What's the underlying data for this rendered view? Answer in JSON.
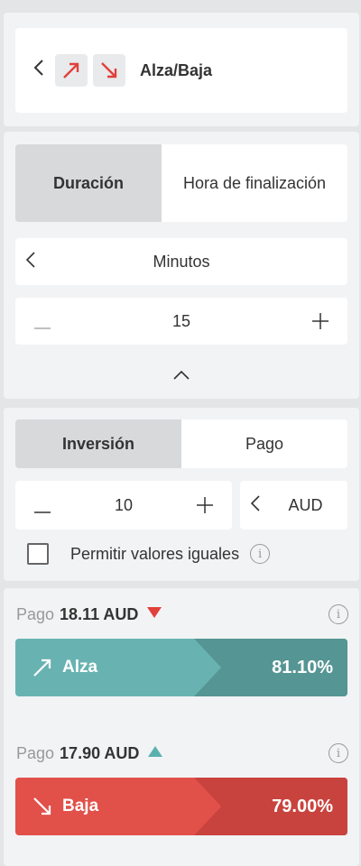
{
  "contract": {
    "back_icon": "chevron-left-icon",
    "title": "Alza/Baja"
  },
  "duration": {
    "tabs": [
      {
        "label": "Duración",
        "active": true
      },
      {
        "label": "Hora de finalización",
        "active": false
      }
    ],
    "unit": "Minutos",
    "value": "15",
    "minus": "—",
    "plus": "+"
  },
  "stake": {
    "tabs": [
      {
        "label": "Inversión",
        "active": true
      },
      {
        "label": "Pago",
        "active": false
      }
    ],
    "amount": "10",
    "minus": "—",
    "plus": "+",
    "currency": "AUD",
    "allow_equals_label": "Permitir valores iguales",
    "allow_equals_checked": false
  },
  "purchase": {
    "up": {
      "payout_label": "Pago",
      "payout_value": "18.11 AUD",
      "button_label": "Alza",
      "percent": "81.10%"
    },
    "down": {
      "payout_label": "Pago",
      "payout_value": "17.90 AUD",
      "button_label": "Baja",
      "percent": "79.00%"
    }
  },
  "colors": {
    "up_button": "#68b3b2",
    "up_button_dark": "#559593",
    "down_button": "#e2504a",
    "down_button_dark": "#c9433e",
    "arrow_red": "#e0413b",
    "arrow_teal": "#5bb0ae"
  }
}
